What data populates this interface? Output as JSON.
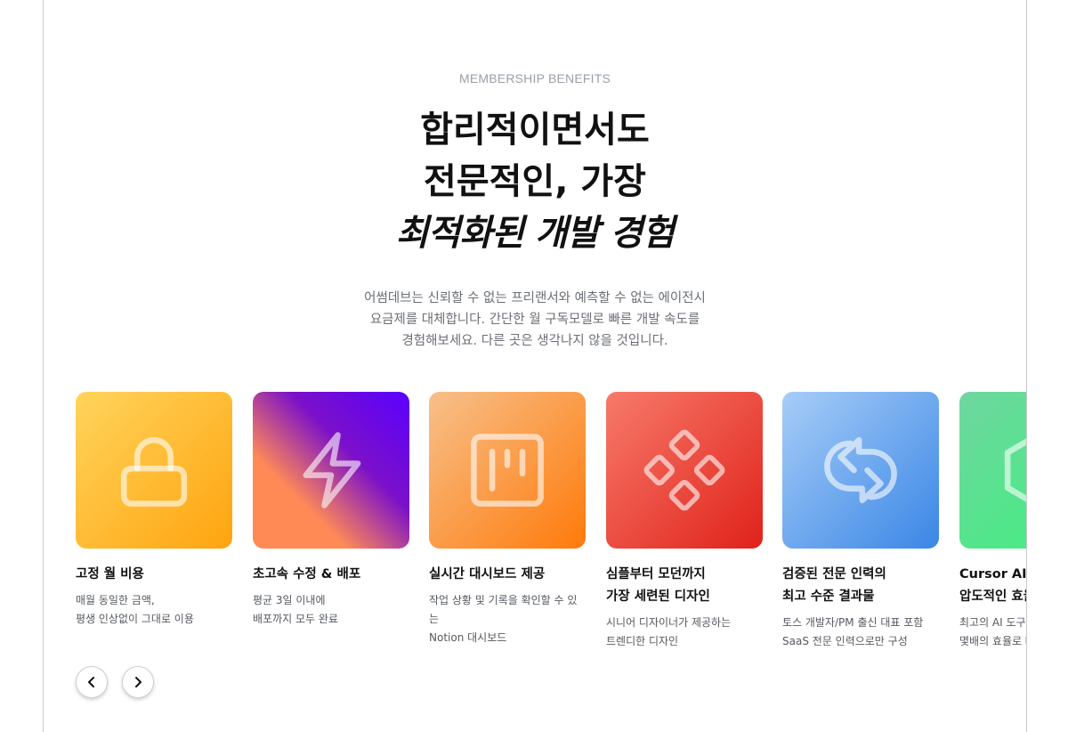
{
  "section": {
    "eyebrow": "MEMBERSHIP BENEFITS",
    "headline_line1": "합리적이면서도",
    "headline_line2": "전문적인, 가장",
    "headline_line3": "최적화된 개발 경험",
    "description_line1": "어썸데브는 신뢰할 수 없는 프리랜서와 예측할 수 없는 에이전시",
    "description_line2": "요금제를 대체합니다. 간단한 월 구독모델로 빠른 개발 속도를",
    "description_line3": "경험해보세요. 다른 곳은 생각나지 않을 것입니다."
  },
  "cards": [
    {
      "icon": "lock-icon",
      "title": "고정 월 비용",
      "desc": "매월 동일한 금액,\n평생 인상없이 그대로 이용",
      "colors": [
        "#ffd45c",
        "#ffa40f"
      ]
    },
    {
      "icon": "lightning-icon",
      "title": "초고속 수정 & 배포",
      "desc": "평균 3일 이내에\n배포까지 모두 완료",
      "colors": [
        "#ff8a55",
        "#7b10c9",
        "#5a00ff"
      ]
    },
    {
      "icon": "board-icon",
      "title": "실시간 대시보드 제공",
      "desc": "작업 상황 및 기록을 확인할 수 있는\nNotion 대시보드",
      "colors": [
        "#f7c08a",
        "#ff7a0a"
      ]
    },
    {
      "icon": "diamonds-icon",
      "title": "심플부터 모던까지\n가장 세련된 디자인",
      "desc": "시니어 디자이너가 제공하는\n트렌디한 디자인",
      "colors": [
        "#f77a6a",
        "#e0221a"
      ]
    },
    {
      "icon": "sync-icon",
      "title": "검증된 전문 인력의\n최고 수준 결과물",
      "desc": "토스 개발자/PM 출신 대표 포함\nSaaS 전문 인력으로만 구성",
      "colors": [
        "#a7cdf7",
        "#3a86e6"
      ]
    },
    {
      "icon": "hexagon-icon",
      "title": "Cursor AI 로\n압도적인 효율",
      "desc": "최고의 AI 도구 활용으로\n몇배의 효율로 빠르게",
      "colors": [
        "#6fd6a0",
        "#3df27a"
      ]
    }
  ],
  "nav": {
    "prev_icon": "chevron-left-icon",
    "next_icon": "chevron-right-icon"
  }
}
